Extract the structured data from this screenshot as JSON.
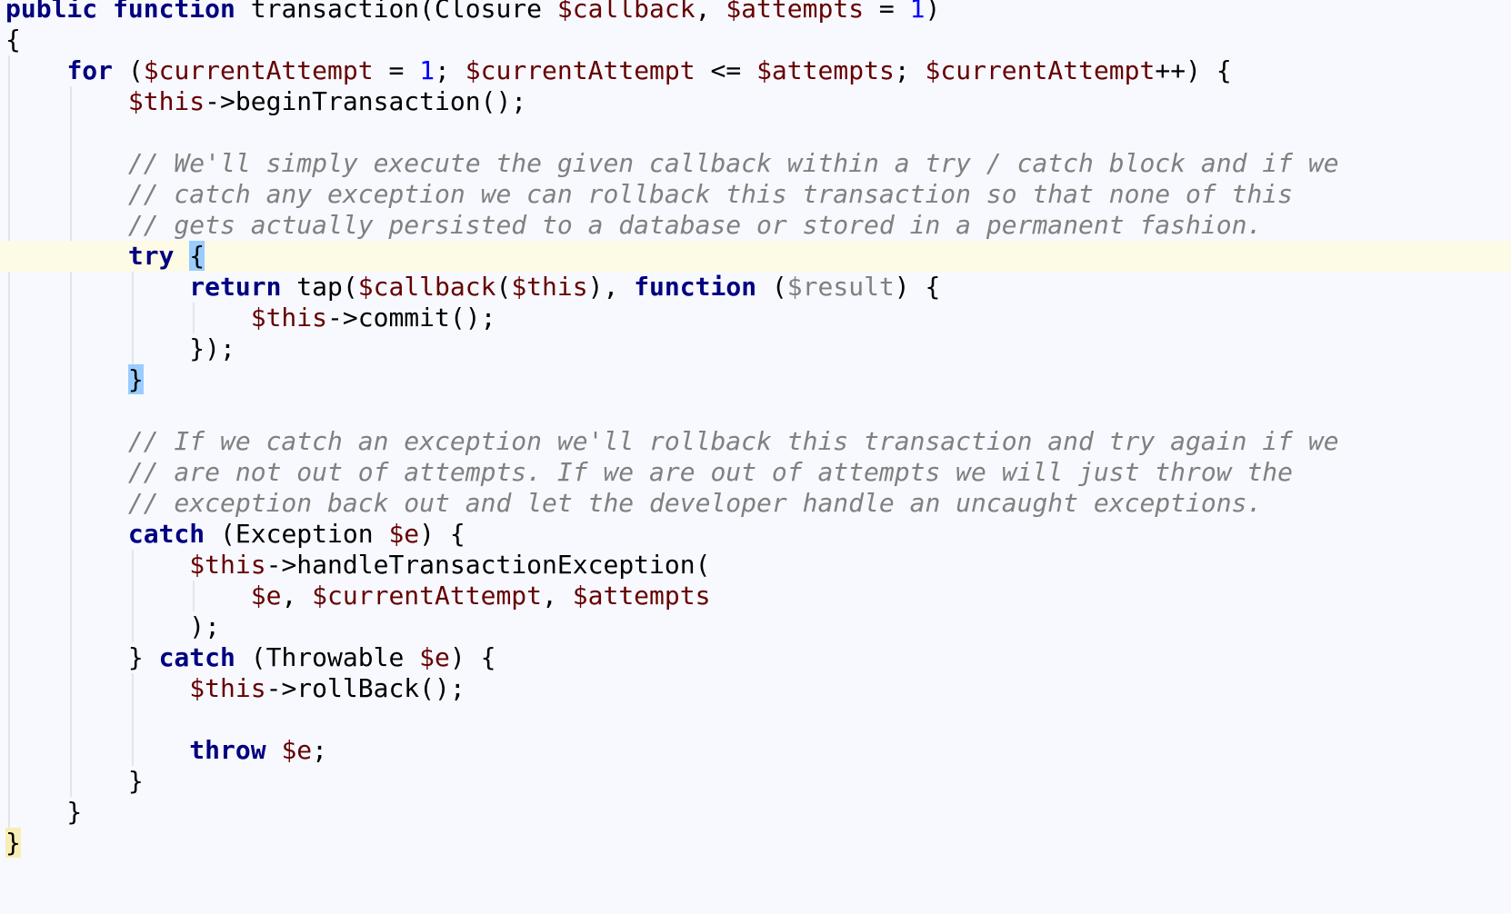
{
  "editor": {
    "language": "php",
    "colors": {
      "background": "#f7f9fe",
      "keyword": "#000080",
      "variable": "#660000",
      "number": "#0000ff",
      "comment": "#808080",
      "current_line": "#fdfae6",
      "brace_match": "#99ccff"
    },
    "current_line": 8,
    "lines": [
      [
        [
          "kw",
          "public"
        ],
        [
          "t",
          " "
        ],
        [
          "kw",
          "function"
        ],
        [
          "t",
          " transaction(Closure "
        ],
        [
          "var",
          "$callback"
        ],
        [
          "t",
          ", "
        ],
        [
          "var",
          "$attempts"
        ],
        [
          "t",
          " = "
        ],
        [
          "num",
          "1"
        ],
        [
          "t",
          ")"
        ]
      ],
      [
        [
          "t",
          "{"
        ]
      ],
      [
        [
          "t",
          "    "
        ],
        [
          "kw",
          "for"
        ],
        [
          "t",
          " ("
        ],
        [
          "var",
          "$currentAttempt"
        ],
        [
          "t",
          " = "
        ],
        [
          "num",
          "1"
        ],
        [
          "t",
          "; "
        ],
        [
          "var",
          "$currentAttempt"
        ],
        [
          "t",
          " <= "
        ],
        [
          "var",
          "$attempts"
        ],
        [
          "t",
          "; "
        ],
        [
          "var",
          "$currentAttempt"
        ],
        [
          "t",
          "++) {"
        ]
      ],
      [
        [
          "t",
          "        "
        ],
        [
          "var",
          "$this"
        ],
        [
          "t",
          "->beginTransaction();"
        ]
      ],
      [],
      [
        [
          "t",
          "        "
        ],
        [
          "com",
          "// We'll simply execute the given callback within a try / catch block and if we"
        ]
      ],
      [
        [
          "t",
          "        "
        ],
        [
          "com",
          "// catch any exception we can rollback this transaction so that none of this"
        ]
      ],
      [
        [
          "t",
          "        "
        ],
        [
          "com",
          "// gets actually persisted to a database or stored in a permanent fashion."
        ]
      ],
      [
        [
          "t",
          "        "
        ],
        [
          "kw",
          "try"
        ],
        [
          "t",
          " "
        ],
        [
          "brace-match",
          "{"
        ]
      ],
      [
        [
          "t",
          "            "
        ],
        [
          "kw",
          "return"
        ],
        [
          "t",
          " tap("
        ],
        [
          "var",
          "$callback"
        ],
        [
          "t",
          "("
        ],
        [
          "var",
          "$this"
        ],
        [
          "t",
          "), "
        ],
        [
          "kw",
          "function"
        ],
        [
          "t",
          " ("
        ],
        [
          "param",
          "$result"
        ],
        [
          "t",
          ") {"
        ]
      ],
      [
        [
          "t",
          "                "
        ],
        [
          "var",
          "$this"
        ],
        [
          "t",
          "->commit();"
        ]
      ],
      [
        [
          "t",
          "            });"
        ]
      ],
      [
        [
          "t",
          "        "
        ],
        [
          "brace-match",
          "}"
        ]
      ],
      [],
      [
        [
          "t",
          "        "
        ],
        [
          "com",
          "// If we catch an exception we'll rollback this transaction and try again if we"
        ]
      ],
      [
        [
          "t",
          "        "
        ],
        [
          "com",
          "// are not out of attempts. If we are out of attempts we will just throw the"
        ]
      ],
      [
        [
          "t",
          "        "
        ],
        [
          "com",
          "// exception back out and let the developer handle an uncaught exceptions."
        ]
      ],
      [
        [
          "t",
          "        "
        ],
        [
          "kw",
          "catch"
        ],
        [
          "t",
          " (Exception "
        ],
        [
          "var",
          "$e"
        ],
        [
          "t",
          ") {"
        ]
      ],
      [
        [
          "t",
          "            "
        ],
        [
          "var",
          "$this"
        ],
        [
          "t",
          "->handleTransactionException("
        ]
      ],
      [
        [
          "t",
          "                "
        ],
        [
          "var",
          "$e"
        ],
        [
          "t",
          ", "
        ],
        [
          "var",
          "$currentAttempt"
        ],
        [
          "t",
          ", "
        ],
        [
          "var",
          "$attempts"
        ]
      ],
      [
        [
          "t",
          "            );"
        ]
      ],
      [
        [
          "t",
          "        } "
        ],
        [
          "kw",
          "catch"
        ],
        [
          "t",
          " (Throwable "
        ],
        [
          "var",
          "$e"
        ],
        [
          "t",
          ") {"
        ]
      ],
      [
        [
          "t",
          "            "
        ],
        [
          "var",
          "$this"
        ],
        [
          "t",
          "->rollBack();"
        ]
      ],
      [],
      [
        [
          "t",
          "            "
        ],
        [
          "kw",
          "throw"
        ],
        [
          "t",
          " "
        ],
        [
          "var",
          "$e"
        ],
        [
          "t",
          ";"
        ]
      ],
      [
        [
          "t",
          "        }"
        ]
      ],
      [
        [
          "t",
          "    }"
        ]
      ],
      [
        [
          "brace-hl",
          "}"
        ]
      ]
    ]
  }
}
